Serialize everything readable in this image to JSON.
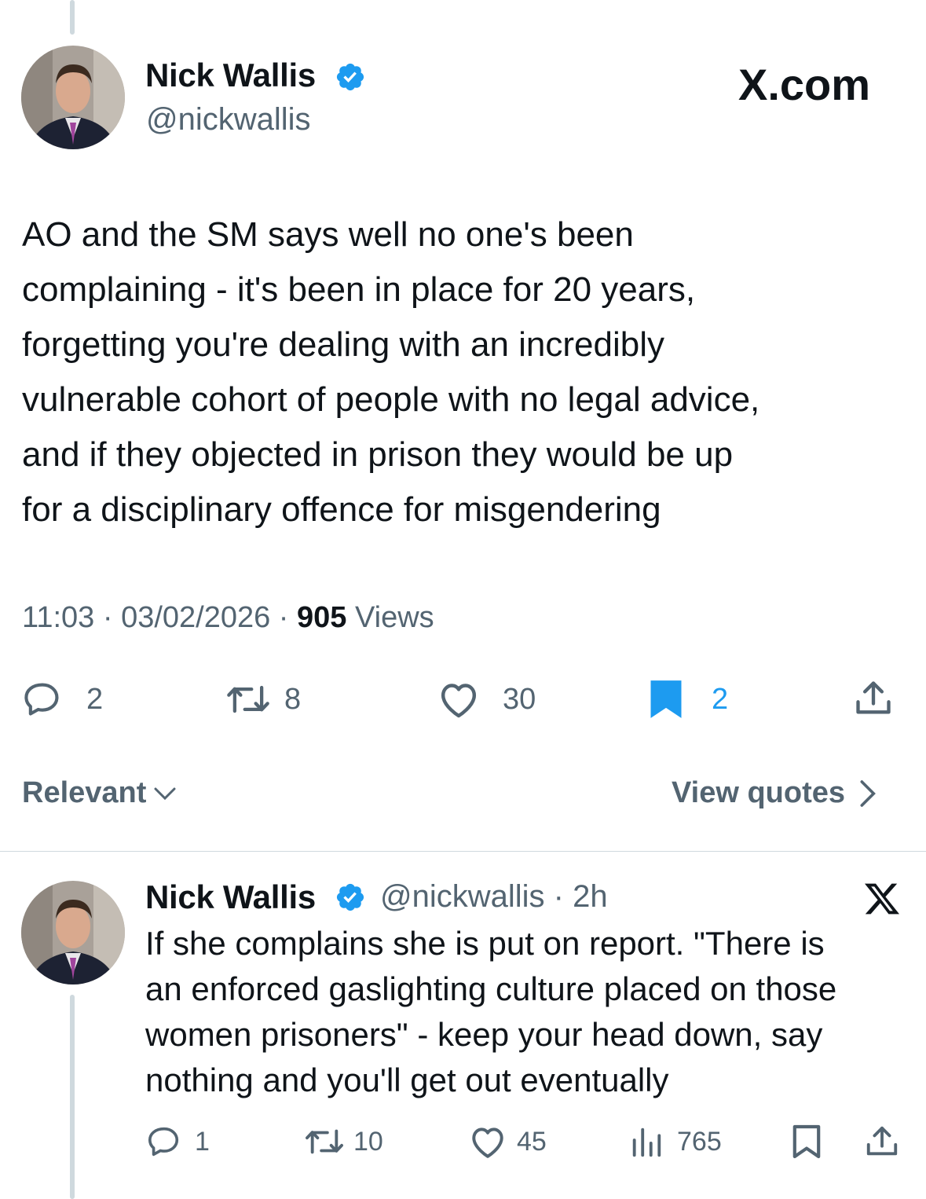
{
  "main_tweet": {
    "author_name": "Nick Wallis",
    "author_handle": "@nickwallis",
    "source_mark": "X.com",
    "text": "AO and the SM says well no one's been\ncomplaining - it's been in place for 20 years,\nforgetting you're dealing with an incredibly\nvulnerable cohort of people with no legal advice,\nand if they objected in prison they would be up\nfor a disciplinary offence for misgendering",
    "time": "11:03",
    "date": "03/02/2026",
    "views_count": "905",
    "views_label": "Views",
    "replies": "2",
    "reposts": "8",
    "likes": "30",
    "bookmarks": "2"
  },
  "sort_bar": {
    "sort_label": "Relevant",
    "quotes_label": "View quotes"
  },
  "reply_tweet": {
    "author_name": "Nick Wallis",
    "author_handle": "@nickwallis",
    "age": "2h",
    "text": "If she complains she is put on report. \"There is\nan enforced gaslighting culture placed on those\nwomen prisoners\" - keep your head down, say\nnothing and you'll get out eventually",
    "replies": "1",
    "reposts": "10",
    "likes": "45",
    "views": "765"
  },
  "colors": {
    "verified_blue": "#1d9bf0",
    "secondary_text": "#536471",
    "bookmark_active": "#1d9bf0"
  },
  "icons": [
    "verified-badge-icon",
    "reply-icon",
    "repost-icon",
    "like-icon",
    "bookmark-icon",
    "share-icon",
    "views-icon",
    "chevron-down-icon",
    "chevron-right-icon",
    "x-logo-icon"
  ]
}
